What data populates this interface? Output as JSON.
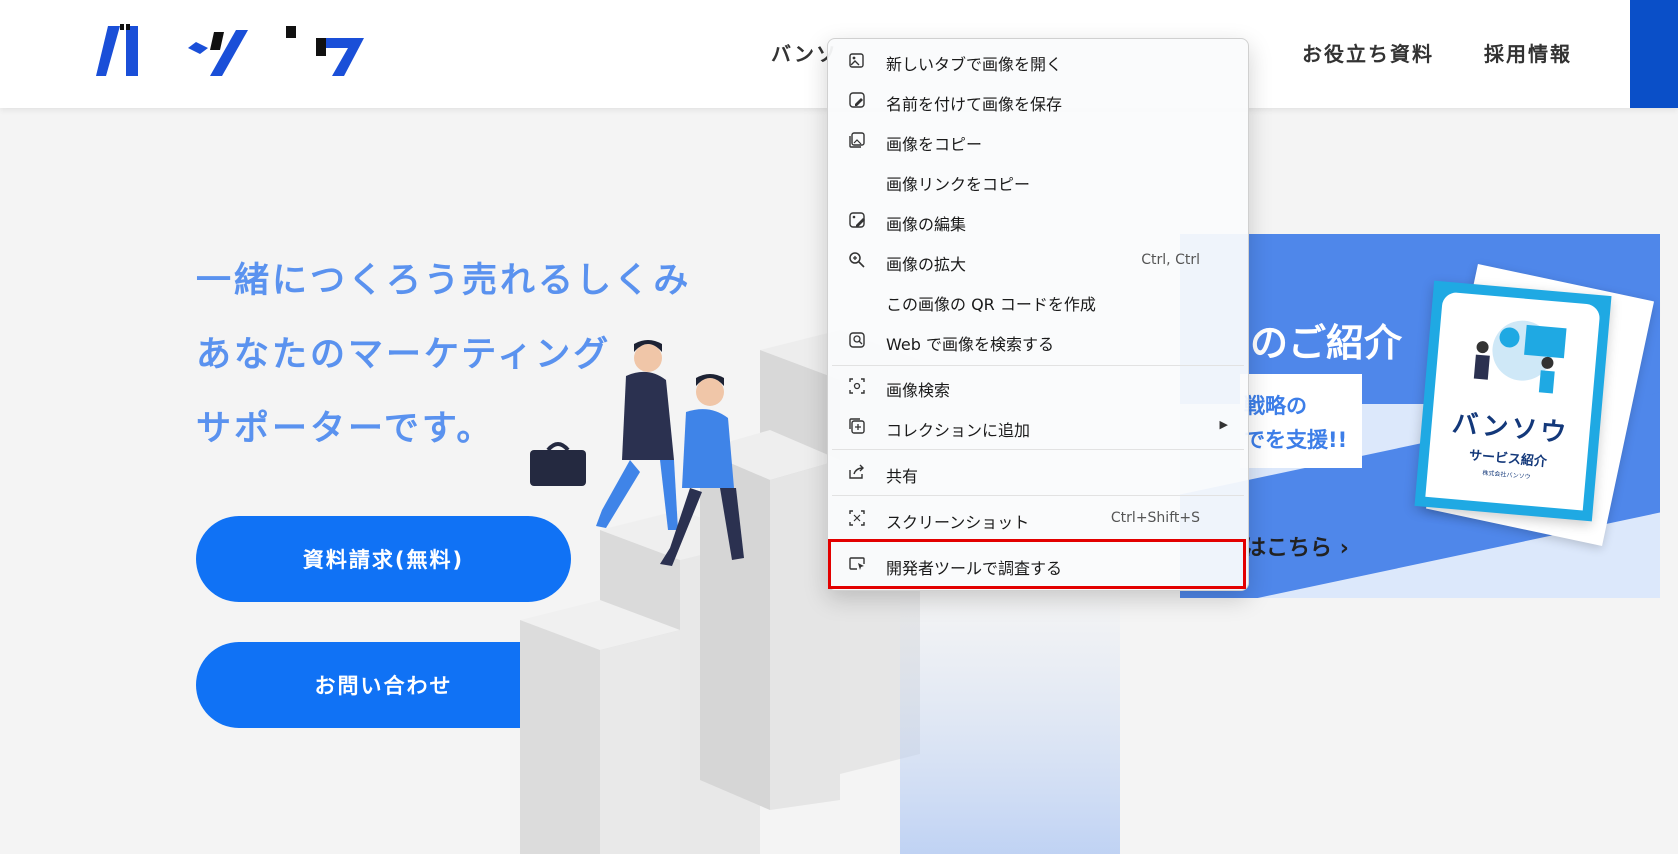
{
  "header": {
    "logo_text": "バンソウ",
    "nav": [
      "バンソ",
      "お役立ち資料",
      "採用情報"
    ]
  },
  "hero": {
    "lines": [
      "一緒につくろう売れるしくみ",
      "あなたのマーケティング",
      "サポーターです。"
    ],
    "cta_primary": "資料請求(無料)",
    "cta_secondary": "お問い合わせ"
  },
  "banner": {
    "title": "のご紹介",
    "line1": "戦略の",
    "line2": "でを支援!!",
    "link": "はこちら"
  },
  "brochure": {
    "logo": "バンソウ",
    "title": "サービス紹介",
    "subtitle": "株式会社バンソウ"
  },
  "context_menu": {
    "items": [
      {
        "label": "新しいタブで画像を開く",
        "icon": "open-image-tab-icon"
      },
      {
        "label": "名前を付けて画像を保存",
        "icon": "save-image-icon"
      },
      {
        "label": "画像をコピー",
        "icon": "copy-image-icon"
      },
      {
        "label": "画像リンクをコピー",
        "icon": ""
      },
      {
        "label": "画像の編集",
        "icon": "edit-image-icon"
      },
      {
        "label": "画像の拡大",
        "shortcut": "Ctrl, Ctrl",
        "icon": "zoom-icon"
      },
      {
        "label": "この画像の QR コードを作成",
        "icon": ""
      },
      {
        "label": "Web で画像を検索する",
        "icon": "web-image-search-icon"
      },
      {
        "label": "画像検索",
        "icon": "visual-search-icon"
      },
      {
        "label": "コレクションに追加",
        "icon": "collection-add-icon",
        "submenu": true
      },
      {
        "label": "共有",
        "icon": "share-icon"
      },
      {
        "label": "スクリーンショット",
        "shortcut": "Ctrl+Shift+S",
        "icon": "screenshot-icon"
      },
      {
        "label": "開発者ツールで調査する",
        "icon": "inspect-icon",
        "highlighted": true
      }
    ]
  },
  "colors": {
    "brand_blue": "#1072f5",
    "hero_text": "#5a92ef",
    "highlight": "#e30000"
  }
}
